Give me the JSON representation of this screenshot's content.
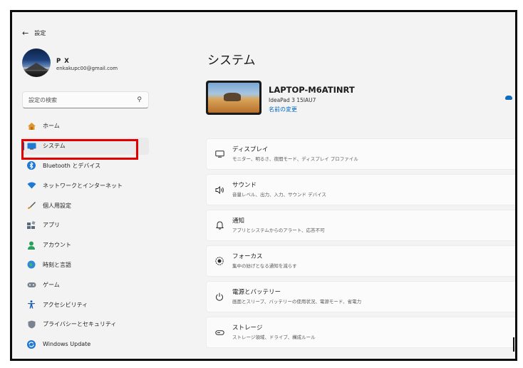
{
  "window": {
    "title": "設定"
  },
  "user": {
    "name": "P X",
    "email": "enkakupc00@gmail.com"
  },
  "search": {
    "placeholder": "設定の検索"
  },
  "sidebar": {
    "items": [
      {
        "label": "ホーム",
        "icon": "home-icon",
        "color": "#d98a28"
      },
      {
        "label": "システム",
        "icon": "system-display-icon",
        "color": "#1f78d1",
        "active": true
      },
      {
        "label": "Bluetooth とデバイス",
        "icon": "bluetooth-icon",
        "color": "#1f78d1"
      },
      {
        "label": "ネットワークとインターネット",
        "icon": "wifi-icon",
        "color": "#1f78d1"
      },
      {
        "label": "個人用設定",
        "icon": "brush-icon",
        "color": "#d6791f"
      },
      {
        "label": "アプリ",
        "icon": "apps-icon",
        "color": "#5a6a7a"
      },
      {
        "label": "アカウント",
        "icon": "account-icon",
        "color": "#2aa05a"
      },
      {
        "label": "時刻と言語",
        "icon": "globe-clock-icon",
        "color": "#1f78d1"
      },
      {
        "label": "ゲーム",
        "icon": "gamepad-icon",
        "color": "#6a7480"
      },
      {
        "label": "アクセシビリティ",
        "icon": "accessibility-icon",
        "color": "#1f5fb0"
      },
      {
        "label": "プライバシーとセキュリティ",
        "icon": "shield-icon",
        "color": "#6a7480"
      },
      {
        "label": "Windows Update",
        "icon": "update-icon",
        "color": "#1f78d1"
      }
    ]
  },
  "main": {
    "title": "システム",
    "device": {
      "name": "LAPTOP-M6ATINRT",
      "model": "IdeaPad 3 15IAU7",
      "rename_link": "名前の変更"
    },
    "cards": [
      {
        "title": "ディスプレイ",
        "subtitle": "モニター、明るさ、夜間モード、ディスプレイ プロファイル",
        "icon": "display-icon"
      },
      {
        "title": "サウンド",
        "subtitle": "音量レベル、出力、入力、サウンド デバイス",
        "icon": "speaker-icon"
      },
      {
        "title": "通知",
        "subtitle": "アプリとシステムからのアラート、応答不可",
        "icon": "bell-icon"
      },
      {
        "title": "フォーカス",
        "subtitle": "集中の妨げとなる通知を減らす",
        "icon": "focus-icon"
      },
      {
        "title": "電源とバッテリー",
        "subtitle": "画面とスリープ、バッテリーの使用状況、電源モード、省電力",
        "icon": "power-icon"
      },
      {
        "title": "ストレージ",
        "subtitle": "ストレージ領域、ドライブ、構成ルール",
        "icon": "storage-icon"
      }
    ]
  },
  "colors": {
    "accent": "#005fb8",
    "link": "#0067c0",
    "highlight_box": "#e00000"
  }
}
